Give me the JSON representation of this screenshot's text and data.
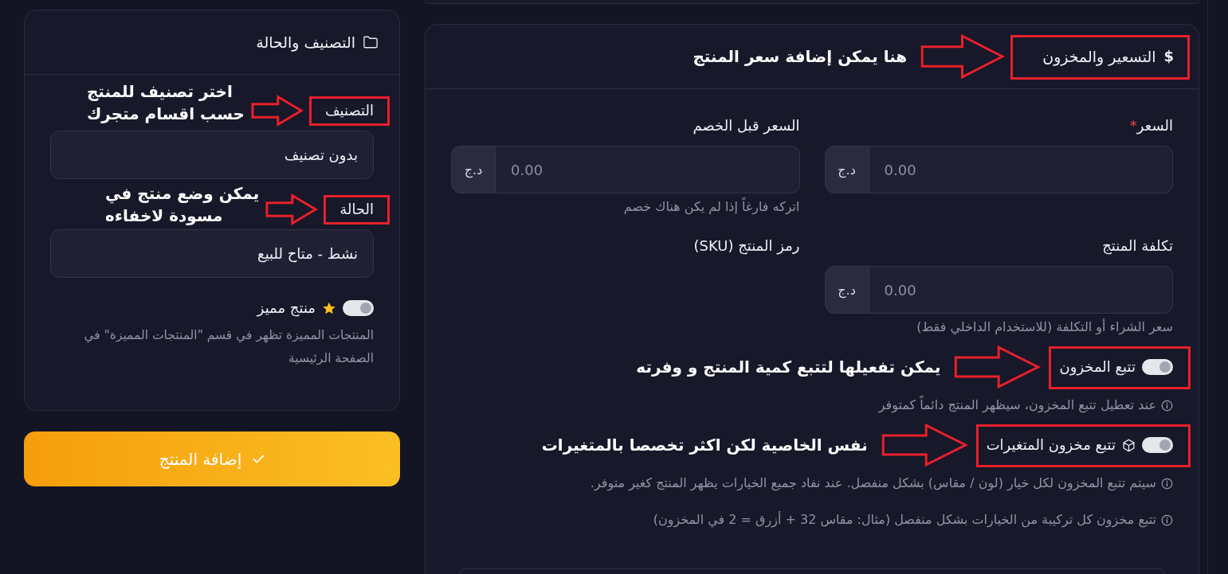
{
  "category_card": {
    "title": "التصنيف والحالة",
    "fields": [
      {
        "label": "التصنيف",
        "value": "بدون تصنيف",
        "callout": "اختر تصنيف للمنتج\nحسب اقسام متجرك"
      },
      {
        "label": "الحالة",
        "value": "نشط - متاح للبيع",
        "callout": "يمكن وضع منتج في\nمسودة لاخفاءه"
      }
    ],
    "featured": {
      "label": "منتج مميز",
      "on": true,
      "hint": "المنتجات المميزة تظهر في قسم \"المنتجات المميزة\" في الصفحة الرئيسية"
    }
  },
  "submit_button": {
    "label": "إضافة المنتج"
  },
  "pricing_card": {
    "title_icon": "$",
    "title": "التسعير والمخزون",
    "callout": "هنا يمكن إضافة سعر المنتج",
    "fields": [
      {
        "kind": "money",
        "label": "السعر",
        "required_mark": "*",
        "currency": "د.ج",
        "placeholder": "0.00"
      },
      {
        "kind": "money",
        "label": "السعر قبل الخصم",
        "currency": "د.ج",
        "placeholder": "0.00",
        "hint": "اتركه فارغاً إذا لم يكن هناك خصم"
      },
      {
        "kind": "money",
        "label": "تكلفة المنتج",
        "currency": "د.ج",
        "placeholder": "0.00",
        "hint": "سعر الشراء أو التكلفة (للاستخدام الداخلي فقط)"
      },
      {
        "kind": "label",
        "label": "رمز المنتج (SKU)"
      }
    ],
    "toggles": [
      {
        "kind": "plain",
        "label": "تتبع المخزون",
        "on": true,
        "callout": "يمكن تفعيلها لتتبع كمية المنتج و وفرته",
        "notes": [
          "عند تعطيل تتبع المخزون، سيظهر المنتج دائماً كمتوفر"
        ]
      },
      {
        "kind": "variants",
        "label": "تتبع مخزون المتغيرات",
        "on": true,
        "callout": "نفس الخاصية لكن اكثر تخصصا بالمتغيرات",
        "notes": [
          "سيتم تتبع المخزون لكل خيار (لون / مقاس) بشكل منفصل. عند نفاد جميع الخيارات يظهر المنتج كغير متوفر.",
          "تتبع مخزون كل تركيبة من الخيارات بشكل منفصل (مثال: مقاس 32 + أزرق = 2 في المخزون)"
        ]
      }
    ]
  }
}
